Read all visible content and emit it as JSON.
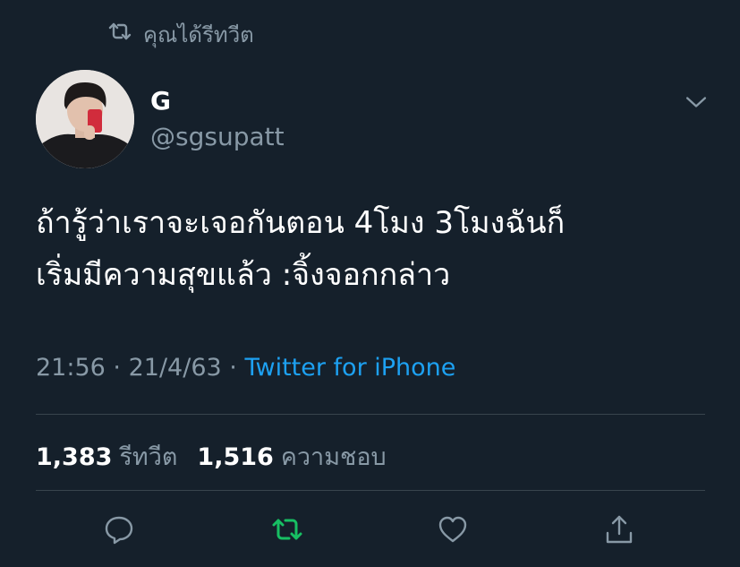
{
  "retweet_context": {
    "icon": "retweet-icon",
    "text": "คุณได้รีทวีต"
  },
  "author": {
    "display_name": "G",
    "handle": "@sgsupatt",
    "avatar": "avatar"
  },
  "tweet": {
    "text": "ถ้ารู้ว่าเราจะเจอกันตอน 4โมง 3โมงฉันก็\nเริ่มมีความสุขแล้ว :จิ้งจอกกล่าว",
    "time": "21:56",
    "separator": "·",
    "date": "21/4/63",
    "source": "Twitter for iPhone"
  },
  "stats": {
    "retweets_count": "1,383",
    "retweets_label": "รีทวีต",
    "likes_count": "1,516",
    "likes_label": "ความชอบ"
  },
  "actions": [
    "reply-icon",
    "retweet-icon",
    "like-icon",
    "share-icon"
  ],
  "colors": {
    "background": "#15202b",
    "text_primary": "#ffffff",
    "text_secondary": "#8899a6",
    "link": "#1da1f2",
    "retweet_active": "#17bf63",
    "divider": "#38444d"
  }
}
